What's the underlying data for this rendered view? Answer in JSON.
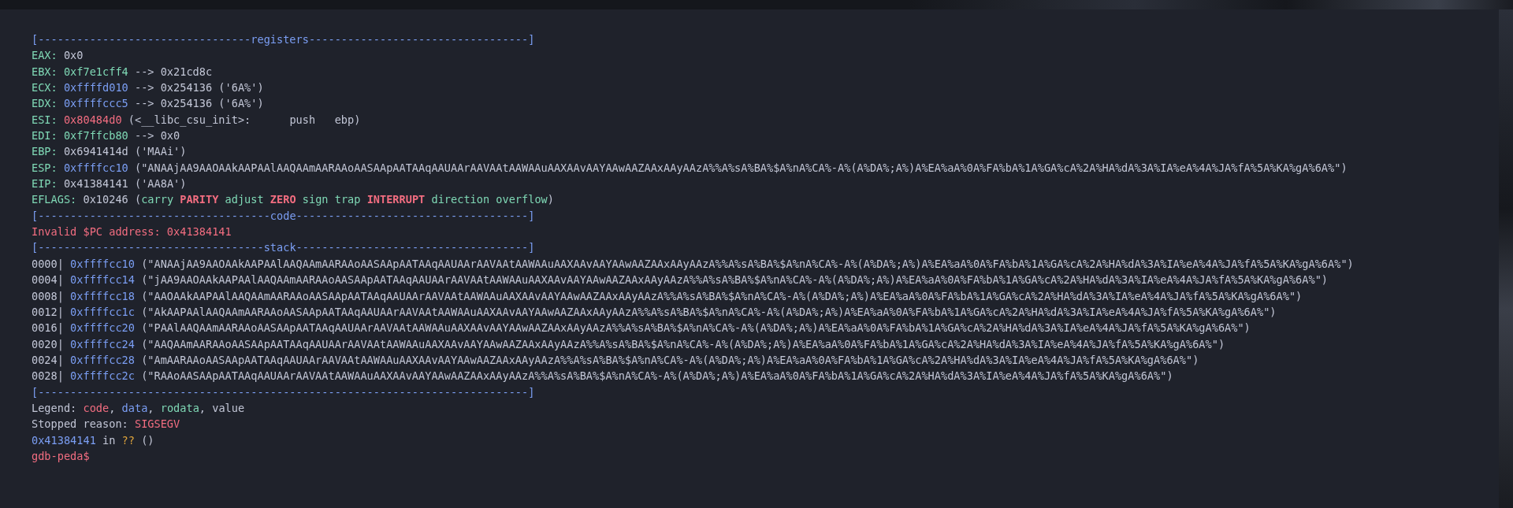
{
  "terminal": {
    "lines": [
      {
        "segments": [
          {
            "text": "[---------------------------------",
            "kind": "header"
          },
          {
            "text": "registers",
            "kind": "header"
          },
          {
            "text": "----------------------------------]",
            "kind": "header"
          }
        ]
      },
      {
        "segments": [
          {
            "text": "EAX:",
            "kind": "label"
          },
          {
            "text": " 0x0",
            "kind": "plain"
          }
        ]
      },
      {
        "segments": [
          {
            "text": "EBX: ",
            "kind": "label"
          },
          {
            "text": "0xf7e1cff4",
            "kind": "rodata"
          },
          {
            "text": " --> 0x21cd8c",
            "kind": "plain"
          }
        ]
      },
      {
        "segments": [
          {
            "text": "ECX: ",
            "kind": "label"
          },
          {
            "text": "0xffffd010",
            "kind": "data"
          },
          {
            "text": " --> 0x254136 ('6A%')",
            "kind": "plain"
          }
        ]
      },
      {
        "segments": [
          {
            "text": "EDX: ",
            "kind": "label"
          },
          {
            "text": "0xffffccc5",
            "kind": "data"
          },
          {
            "text": " --> 0x254136 ('6A%')",
            "kind": "plain"
          }
        ]
      },
      {
        "segments": [
          {
            "text": "ESI: ",
            "kind": "label"
          },
          {
            "text": "0x80484d0",
            "kind": "code"
          },
          {
            "text": " (<__libc_csu_init>:\tpush   ebp)",
            "kind": "plain"
          }
        ]
      },
      {
        "segments": [
          {
            "text": "EDI: ",
            "kind": "label"
          },
          {
            "text": "0xf7ffcb80",
            "kind": "rodata"
          },
          {
            "text": " --> 0x0",
            "kind": "plain"
          }
        ]
      },
      {
        "segments": [
          {
            "text": "EBP:",
            "kind": "label"
          },
          {
            "text": " 0x6941414d ('MAAi')",
            "kind": "plain"
          }
        ]
      },
      {
        "segments": [
          {
            "text": "ESP: ",
            "kind": "label"
          },
          {
            "text": "0xffffcc10",
            "kind": "data"
          },
          {
            "text": " (\"ANAAjAA9AAOAAkAAPAAlAAQAAmAARAAoAASAApAATAAqAAUAArAAVAAtAAWAAuAAXAAvAAYAAwAAZAAxAAyAAzA%%A%sA%BA%$A%nA%CA%-A%(A%DA%;A%)A%EA%aA%0A%FA%bA%1A%GA%cA%2A%HA%dA%3A%IA%eA%4A%JA%fA%5A%KA%gA%6A%\")",
            "kind": "plain"
          }
        ]
      },
      {
        "segments": [
          {
            "text": "EIP:",
            "kind": "label"
          },
          {
            "text": " 0x41384141 ('AA8A')",
            "kind": "plain"
          }
        ]
      },
      {
        "segments": [
          {
            "text": "EFLAGS:",
            "kind": "label"
          },
          {
            "text": " 0x10246 (",
            "kind": "plain"
          },
          {
            "text": "carry ",
            "kind": "label"
          },
          {
            "text": "PARITY",
            "kind": "flag_set"
          },
          {
            "text": " adjust ",
            "kind": "label"
          },
          {
            "text": "ZERO",
            "kind": "flag_set"
          },
          {
            "text": " sign trap ",
            "kind": "label"
          },
          {
            "text": "INTERRUPT",
            "kind": "flag_set"
          },
          {
            "text": " direction overflow",
            "kind": "label"
          },
          {
            "text": ")",
            "kind": "plain"
          }
        ]
      },
      {
        "segments": [
          {
            "text": "[------------------------------------",
            "kind": "header"
          },
          {
            "text": "code",
            "kind": "header"
          },
          {
            "text": "------------------------------------]",
            "kind": "header"
          }
        ]
      },
      {
        "segments": [
          {
            "text": "Invalid $PC address: 0x41384141",
            "kind": "code"
          }
        ]
      },
      {
        "segments": [
          {
            "text": "[-----------------------------------",
            "kind": "header"
          },
          {
            "text": "stack",
            "kind": "header"
          },
          {
            "text": "------------------------------------]",
            "kind": "header"
          }
        ]
      },
      {
        "segments": [
          {
            "text": "0000| ",
            "kind": "plain"
          },
          {
            "text": "0xffffcc10",
            "kind": "data"
          },
          {
            "text": " (\"ANAAjAA9AAOAAkAAPAAlAAQAAmAARAAoAASAApAATAAqAAUAArAAVAAtAAWAAuAAXAAvAAYAAwAAZAAxAAyAAzA%%A%sA%BA%$A%nA%CA%-A%(A%DA%;A%)A%EA%aA%0A%FA%bA%1A%GA%cA%2A%HA%dA%3A%IA%eA%4A%JA%fA%5A%KA%gA%6A%\")",
            "kind": "plain"
          }
        ]
      },
      {
        "segments": [
          {
            "text": "0004| ",
            "kind": "plain"
          },
          {
            "text": "0xffffcc14",
            "kind": "data"
          },
          {
            "text": " (\"jAA9AAOAAkAAPAAlAAQAAmAARAAoAASAApAATAAqAAUAArAAVAAtAAWAAuAAXAAvAAYAAwAAZAAxAAyAAzA%%A%sA%BA%$A%nA%CA%-A%(A%DA%;A%)A%EA%aA%0A%FA%bA%1A%GA%cA%2A%HA%dA%3A%IA%eA%4A%JA%fA%5A%KA%gA%6A%\")",
            "kind": "plain"
          }
        ]
      },
      {
        "segments": [
          {
            "text": "0008| ",
            "kind": "plain"
          },
          {
            "text": "0xffffcc18",
            "kind": "data"
          },
          {
            "text": " (\"AAOAAkAAPAAlAAQAAmAARAAoAASAApAATAAqAAUAArAAVAAtAAWAAuAAXAAvAAYAAwAAZAAxAAyAAzA%%A%sA%BA%$A%nA%CA%-A%(A%DA%;A%)A%EA%aA%0A%FA%bA%1A%GA%cA%2A%HA%dA%3A%IA%eA%4A%JA%fA%5A%KA%gA%6A%\")",
            "kind": "plain"
          }
        ]
      },
      {
        "segments": [
          {
            "text": "0012| ",
            "kind": "plain"
          },
          {
            "text": "0xffffcc1c",
            "kind": "data"
          },
          {
            "text": " (\"AkAAPAAlAAQAAmAARAAoAASAApAATAAqAAUAArAAVAAtAAWAAuAAXAAvAAYAAwAAZAAxAAyAAzA%%A%sA%BA%$A%nA%CA%-A%(A%DA%;A%)A%EA%aA%0A%FA%bA%1A%GA%cA%2A%HA%dA%3A%IA%eA%4A%JA%fA%5A%KA%gA%6A%\")",
            "kind": "plain"
          }
        ]
      },
      {
        "segments": [
          {
            "text": "0016| ",
            "kind": "plain"
          },
          {
            "text": "0xffffcc20",
            "kind": "data"
          },
          {
            "text": " (\"PAAlAAQAAmAARAAoAASAApAATAAqAAUAArAAVAAtAAWAAuAAXAAvAAYAAwAAZAAxAAyAAzA%%A%sA%BA%$A%nA%CA%-A%(A%DA%;A%)A%EA%aA%0A%FA%bA%1A%GA%cA%2A%HA%dA%3A%IA%eA%4A%JA%fA%5A%KA%gA%6A%\")",
            "kind": "plain"
          }
        ]
      },
      {
        "segments": [
          {
            "text": "0020| ",
            "kind": "plain"
          },
          {
            "text": "0xffffcc24",
            "kind": "data"
          },
          {
            "text": " (\"AAQAAmAARAAoAASAApAATAAqAAUAArAAVAAtAAWAAuAAXAAvAAYAAwAAZAAxAAyAAzA%%A%sA%BA%$A%nA%CA%-A%(A%DA%;A%)A%EA%aA%0A%FA%bA%1A%GA%cA%2A%HA%dA%3A%IA%eA%4A%JA%fA%5A%KA%gA%6A%\")",
            "kind": "plain"
          }
        ]
      },
      {
        "segments": [
          {
            "text": "0024| ",
            "kind": "plain"
          },
          {
            "text": "0xffffcc28",
            "kind": "data"
          },
          {
            "text": " (\"AmAARAAoAASAApAATAAqAAUAArAAVAAtAAWAAuAAXAAvAAYAAwAAZAAxAAyAAzA%%A%sA%BA%$A%nA%CA%-A%(A%DA%;A%)A%EA%aA%0A%FA%bA%1A%GA%cA%2A%HA%dA%3A%IA%eA%4A%JA%fA%5A%KA%gA%6A%\")",
            "kind": "plain"
          }
        ]
      },
      {
        "segments": [
          {
            "text": "0028| ",
            "kind": "plain"
          },
          {
            "text": "0xffffcc2c",
            "kind": "data"
          },
          {
            "text": " (\"RAAoAASAApAATAAqAAUAArAAVAAtAAWAAuAAXAAvAAYAAwAAZAAxAAyAAzA%%A%sA%BA%$A%nA%CA%-A%(A%DA%;A%)A%EA%aA%0A%FA%bA%1A%GA%cA%2A%HA%dA%3A%IA%eA%4A%JA%fA%5A%KA%gA%6A%\")",
            "kind": "plain"
          }
        ]
      },
      {
        "segments": [
          {
            "text": "[----------------------------------------------------------------------------]",
            "kind": "header"
          }
        ]
      },
      {
        "segments": [
          {
            "text": "Legend: ",
            "kind": "plain"
          },
          {
            "text": "code",
            "kind": "code"
          },
          {
            "text": ", ",
            "kind": "plain"
          },
          {
            "text": "data",
            "kind": "data"
          },
          {
            "text": ", ",
            "kind": "plain"
          },
          {
            "text": "rodata",
            "kind": "label"
          },
          {
            "text": ", value",
            "kind": "plain"
          }
        ]
      },
      {
        "segments": [
          {
            "text": "Stopped reason: ",
            "kind": "plain"
          },
          {
            "text": "SIGSEGV",
            "kind": "code"
          }
        ]
      },
      {
        "segments": [
          {
            "text": "0x41384141",
            "kind": "data"
          },
          {
            "text": " in ",
            "kind": "plain"
          },
          {
            "text": "??",
            "kind": "unknown"
          },
          {
            "text": " ()",
            "kind": "plain"
          }
        ]
      },
      {
        "segments": [
          {
            "text": "gdb-peda$",
            "kind": "prompt"
          }
        ]
      }
    ]
  }
}
